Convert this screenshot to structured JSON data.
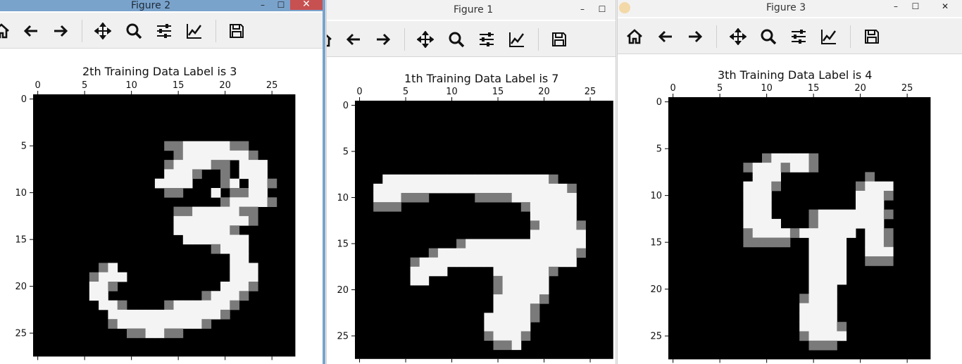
{
  "desktop": {
    "bg": "#f0f0f0"
  },
  "windows": [
    {
      "id": "fig2",
      "title": "Figure 2",
      "plot_title": "2th Training Data Label is 3",
      "label": 3,
      "x_ticks": [
        "0",
        "5",
        "10",
        "15",
        "20",
        "25"
      ],
      "y_ticks": [
        "0",
        "5",
        "10",
        "15",
        "20",
        "25"
      ],
      "active": true
    },
    {
      "id": "fig1",
      "title": "Figure 1",
      "plot_title": "1th Training Data Label is 7",
      "label": 7,
      "x_ticks": [
        "0",
        "5",
        "10",
        "15",
        "20",
        "25"
      ],
      "y_ticks": [
        "0",
        "5",
        "10",
        "15",
        "20",
        "25"
      ],
      "active": false
    },
    {
      "id": "fig3",
      "title": "Figure 3",
      "plot_title": "3th Training Data Label is 4",
      "label": 4,
      "x_ticks": [
        "0",
        "5",
        "10",
        "15",
        "20",
        "25"
      ],
      "y_ticks": [
        "0",
        "5",
        "10",
        "15",
        "20",
        "25"
      ],
      "active": false
    }
  ],
  "toolbar_icons": [
    "home-icon",
    "back-arrow-icon",
    "forward-arrow-icon",
    "pan-icon",
    "zoom-icon",
    "configure-subplots-icon",
    "edit-axis-icon",
    "save-icon"
  ],
  "titlebar_glyphs": {
    "minimize": "–",
    "maximize": "☐",
    "close": "✕"
  },
  "images": {
    "fig2": {
      "rows": [
        "............................",
        "............................",
        "............................",
        "............................",
        "............................",
        "..............aabbbbbaa.....",
        "...............abbbbbbba....",
        "..............abbbbaa.bbb...",
        "..............bbba..a.bbb...",
        ".............bbbb...ab.bba..",
        "..............aa...b.aabb...",
        "....................abbbba..",
        "...............aabbbbbaa....",
        "...............bbbbbbbba....",
        "...............bbbbbba......",
        "................bbbbbbb.....",
        "...................abbb.....",
        ".....................bb.....",
        ".......ab............bbb....",
        "......abbb...........bbb....",
        "......bba...........bbba....",
        "......bb..........abbba.....",
        ".......bba....abbbbbba......",
        "........bbbbbbbbbbbba.......",
        "........abbbbbbbbba.........",
        "..........aabbaa............",
        "............................",
        "............................"
      ]
    },
    "fig1": {
      "rows": [
        "............................",
        "............................",
        "............................",
        "............................",
        "............................",
        "............................",
        "............................",
        "............................",
        "...bbbbbbbbbbbbbbbbbba......",
        "..bbbbbbbbbbbbbbbbbbbbba....",
        "..bbbaaa.....aaaabbbbbbb....",
        "..aaa.............abbbbb....",
        "...................bbbbb....",
        "...................abbbba...",
        "...................bbbbbb...",
        "...........abbbbbbbbbbbbb...",
        "........abbbbbbbbbbbbbbba...",
        "......abbbbbbbbbbbbbbbbb....",
        "......bbbb.....bbbbbba......",
        "......bb.......abbbbb.......",
        "...............abbbbb.......",
        "...............bbbbba.......",
        "...............bbbba........",
        "..............bbbbba........",
        "..............bbbbb.........",
        "..............abbba.........",
        "...............aab..........",
        "............................"
      ]
    },
    "fig3": {
      "rows": [
        "............................",
        "............................",
        "............................",
        "............................",
        "............................",
        "............................",
        "..........abbbba............",
        "........abbbabba............",
        ".........bbb.........a......",
        "........bbba........abbb....",
        "........bbb.........bbba....",
        "........bbb.........bbb.....",
        "........bbb....abbbbbbba....",
        "........bbbb...abbbbbbb.....",
        "........abbbbabbbbbb.bba....",
        "........aaaaa..bbbb..bba....",
        "...............bbbb..bbb....",
        "...............bbbb..aaa....",
        "...............bbbb.........",
        "...............bbbb.........",
        "...............bbb..........",
        "..............abbb..........",
        "..............bbbb..........",
        "..............bbbb..........",
        "..............bbbba.........",
        "..............abbbb.........",
        "...............aaa..........",
        "............................"
      ]
    }
  }
}
